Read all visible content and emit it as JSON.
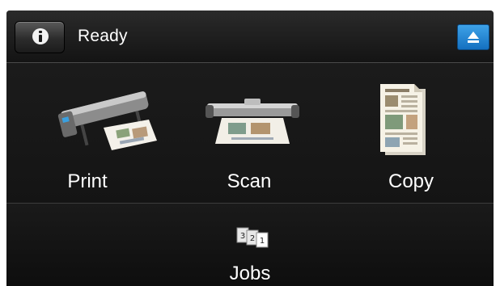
{
  "status_bar": {
    "info_icon": "info-icon",
    "status_text": "Ready",
    "eject_icon": "eject-icon",
    "eject_color": "#1d7fd2"
  },
  "tiles": [
    {
      "label": "Print",
      "icon": "printer-icon"
    },
    {
      "label": "Scan",
      "icon": "scanner-icon"
    },
    {
      "label": "Copy",
      "icon": "copy-document-icon"
    }
  ],
  "jobs": {
    "label": "Jobs",
    "icon": "jobs-queue-icon"
  }
}
